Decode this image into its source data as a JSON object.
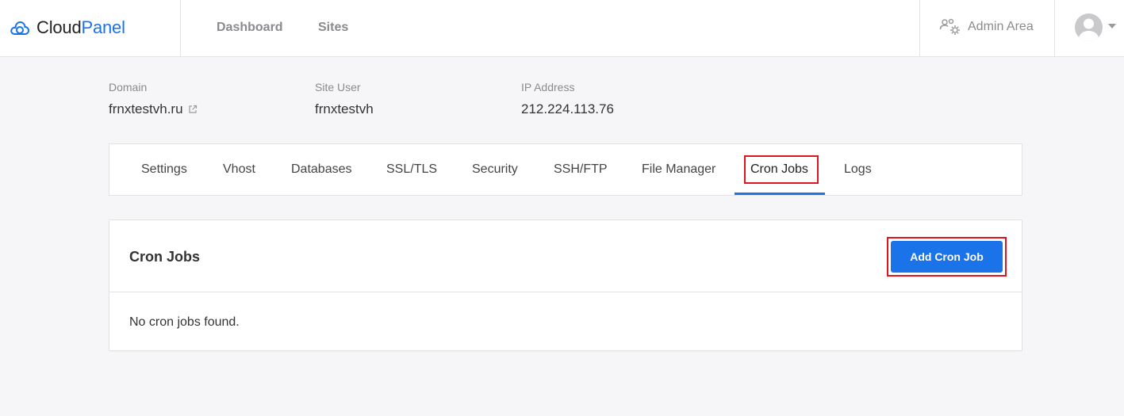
{
  "app": {
    "logo_cloud": "Cloud",
    "logo_panel": "Panel",
    "nav": {
      "dashboard": "Dashboard",
      "sites": "Sites"
    },
    "admin_area": "Admin Area"
  },
  "site": {
    "domain_label": "Domain",
    "domain_value": "frnxtestvh.ru",
    "user_label": "Site User",
    "user_value": "frnxtestvh",
    "ip_label": "IP Address",
    "ip_value": "212.224.113.76"
  },
  "tabs": [
    {
      "label": "Settings"
    },
    {
      "label": "Vhost"
    },
    {
      "label": "Databases"
    },
    {
      "label": "SSL/TLS"
    },
    {
      "label": "Security"
    },
    {
      "label": "SSH/FTP"
    },
    {
      "label": "File Manager"
    },
    {
      "label": "Cron Jobs",
      "active": true
    },
    {
      "label": "Logs"
    }
  ],
  "card": {
    "title": "Cron Jobs",
    "add_button": "Add Cron Job",
    "empty_message": "No cron jobs found."
  },
  "colors": {
    "accent": "#1a73e8",
    "highlight": "#e0141e"
  },
  "icons": {
    "logo": "cloud-logo-icon",
    "admin": "admin-users-gear-icon",
    "external": "external-link-icon",
    "avatar": "user-avatar-icon",
    "caret": "chevron-down-icon"
  }
}
